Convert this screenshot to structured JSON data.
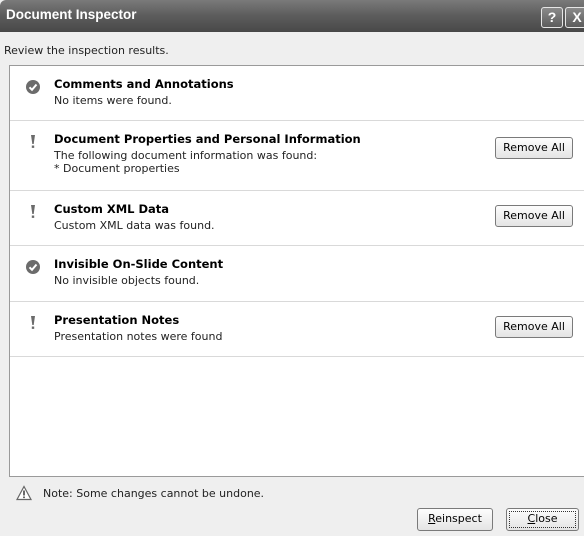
{
  "window": {
    "title": "Document Inspector",
    "help_label": "?",
    "close_label": "X"
  },
  "subtitle": "Review the inspection results.",
  "results": [
    {
      "title": "Comments and Annotations",
      "description": "No items were found.",
      "status": "passed",
      "icon": "check-circle-icon"
    },
    {
      "title": "Document Properties and Personal Information",
      "description": "The following document information was found:",
      "detail": "* Document properties",
      "status": "issue",
      "icon": "exclamation-icon",
      "action_label": "Remove All"
    },
    {
      "title": "Custom XML Data",
      "description": "Custom XML data was found.",
      "status": "issue",
      "icon": "exclamation-icon",
      "action_label": "Remove All"
    },
    {
      "title": "Invisible On-Slide Content",
      "description": "No invisible objects found.",
      "status": "passed",
      "icon": "check-circle-icon"
    },
    {
      "title": "Presentation Notes",
      "description": "Presentation notes were found",
      "status": "issue",
      "icon": "exclamation-icon",
      "action_label": "Remove All"
    }
  ],
  "footer": {
    "note": "Note: Some changes cannot be undone.",
    "note_icon": "warning-icon",
    "reinspect_label_access": "R",
    "reinspect_label_rest": "einspect",
    "close_label_access": "C",
    "close_label_rest": "lose"
  }
}
